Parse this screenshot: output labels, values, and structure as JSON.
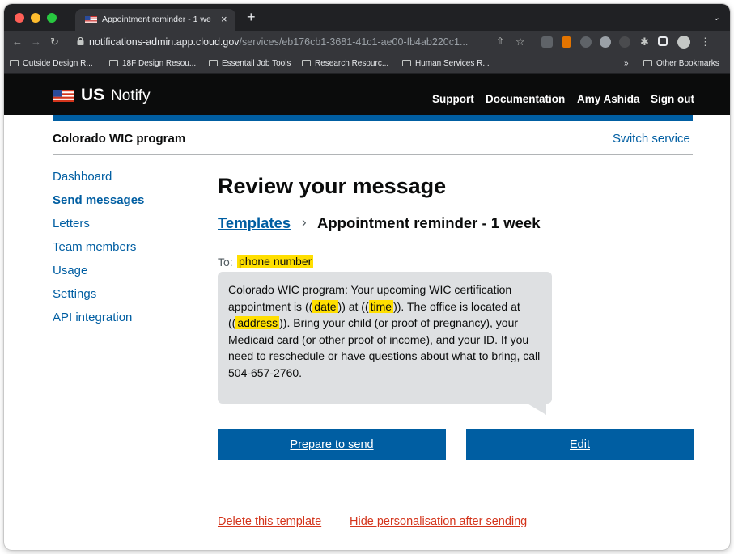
{
  "browser": {
    "tab_title": "Appointment reminder - 1 wee",
    "tab_close": "×",
    "new_tab": "+",
    "tab_menu": "⌄",
    "url_host": "notifications-admin.app.cloud.gov",
    "url_path": "/services/eb176cb1-3681-41c1-ae00-fb4ab220c1...",
    "bookmarks": [
      "Outside Design R...",
      "18F Design Resou...",
      "Essentail Job Tools",
      "Research Resourc...",
      "Human Services R..."
    ],
    "bookmarks_overflow": "»",
    "other_bookmarks": "Other Bookmarks"
  },
  "header": {
    "logo_us": "US",
    "logo_notify": "Notify",
    "nav": [
      "Support",
      "Documentation",
      "Amy Ashida",
      "Sign out"
    ]
  },
  "service": {
    "name": "Colorado WIC program",
    "switch_label": "Switch service"
  },
  "sidebar": {
    "items": [
      {
        "label": "Dashboard"
      },
      {
        "label": "Send messages"
      },
      {
        "label": "Letters"
      },
      {
        "label": "Team members"
      },
      {
        "label": "Usage"
      },
      {
        "label": "Settings"
      },
      {
        "label": "API integration"
      }
    ]
  },
  "main": {
    "title": "Review your message",
    "breadcrumb_link": "Templates",
    "breadcrumb_sep": "›",
    "breadcrumb_current": "Appointment reminder - 1 week",
    "to_label": "To:",
    "to_value": "phone number",
    "message": {
      "p1": "Colorado WIC program: Your upcoming WIC certification appointment is ((",
      "date": "date",
      "p2": ")) at ((",
      "time": "time",
      "p3": ")). The office is located at ((",
      "address": "address",
      "p4": ")). Bring your child (or proof of pregnancy), your Medicaid card (or other proof of income), and your ID. If you need to reschedule or have questions about what to bring, call 504-657-2760."
    },
    "prepare_button": "Prepare to send",
    "edit_button": "Edit",
    "delete_link": "Delete this template",
    "hide_link": "Hide personalisation after sending"
  }
}
